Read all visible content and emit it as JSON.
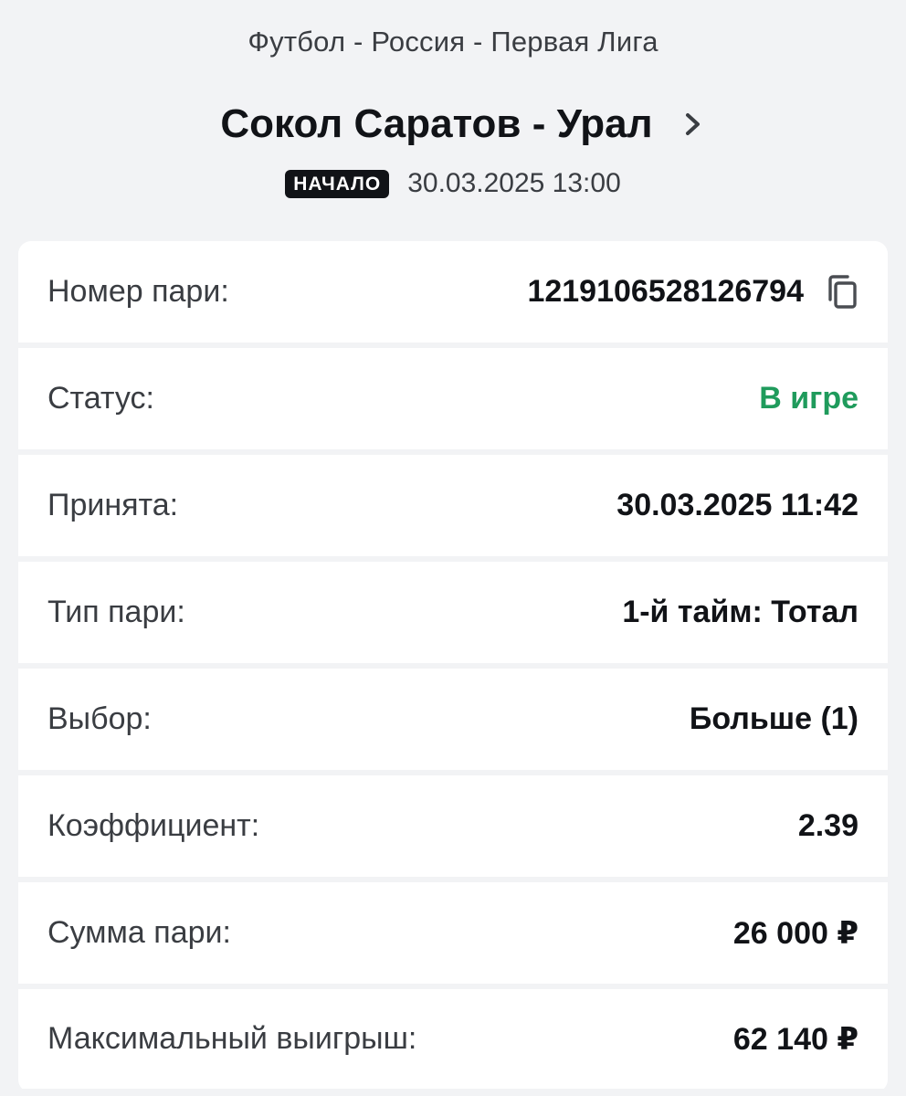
{
  "header": {
    "league": "Футбол - Россия - Первая Лига",
    "match_title": "Сокол Саратов - Урал",
    "badge": "НАЧАЛО",
    "start_datetime": "30.03.2025 13:00"
  },
  "bet": {
    "rows": [
      {
        "label": "Номер пари:",
        "value": "1219106528126794"
      },
      {
        "label": "Статус:",
        "value": "В игре"
      },
      {
        "label": "Принята:",
        "value": "30.03.2025 11:42"
      },
      {
        "label": "Тип пари:",
        "value": "1-й тайм: Тотал"
      },
      {
        "label": "Выбор:",
        "value": "Больше (1)"
      },
      {
        "label": "Коэффициент:",
        "value": "2.39"
      },
      {
        "label": "Сумма пари:",
        "value": "26 000 ₽"
      },
      {
        "label": "Максимальный выигрыш:",
        "value": "62 140 ₽"
      }
    ]
  },
  "icons": {
    "chevron": "chevron-right-icon",
    "copy": "copy-icon"
  },
  "colors": {
    "background": "#f2f3f5",
    "card": "#ffffff",
    "status_green": "#1f9b5c",
    "badge_bg": "#111317"
  }
}
